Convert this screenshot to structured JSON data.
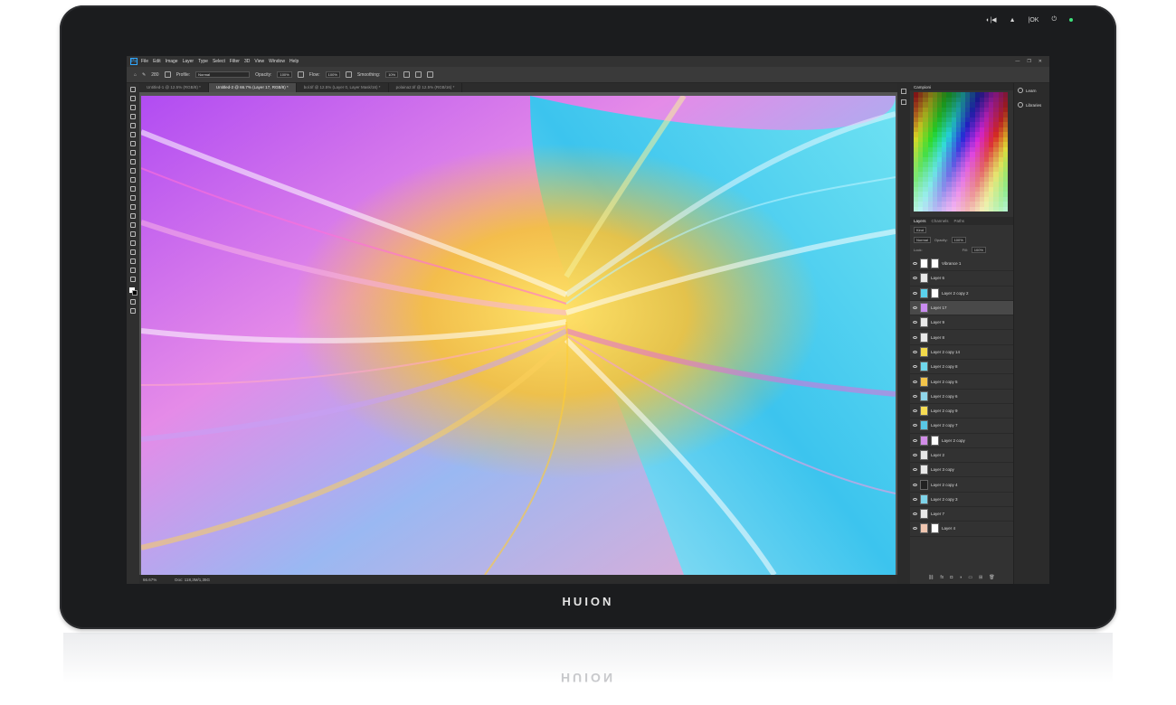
{
  "device": {
    "brand": "HUION",
    "bezel_icons": [
      "power-menu-icon",
      "back-icon",
      "up-icon",
      "ok-icon",
      "power-icon"
    ],
    "bezel_labels": {
      "menu": "◐|◀",
      "up": "▲",
      "ok": "|OK",
      "power": "⏻"
    },
    "led_color": "#3ee07a"
  },
  "app": {
    "menu": [
      "File",
      "Edit",
      "Image",
      "Layer",
      "Type",
      "Select",
      "Filter",
      "3D",
      "View",
      "Window",
      "Help"
    ],
    "window_controls": [
      "—",
      "❐",
      "✕"
    ],
    "options": {
      "profile_label": "Profile:",
      "mode_value": "Normal",
      "opacity_label": "Opacity:",
      "opacity_value": "100%",
      "flow_label": "Flow:",
      "flow_value": "100%",
      "smoothing_label": "Smoothing:",
      "smoothing_value": "10%",
      "brush_size": "280"
    },
    "tabs": [
      {
        "label": "Untitled-1 @ 12.5% (RGB/8) *",
        "active": false
      },
      {
        "label": "Untitled-2 @ 66.7% (Layer 17, RGB/8) *",
        "active": true
      },
      {
        "label": "bol.tif @ 12.5% (Layer 0, Layer Mask/16) *",
        "active": false
      },
      {
        "label": "polaina2.tif @ 12.5% (RGB/16) *",
        "active": false
      }
    ],
    "status": {
      "zoom": "66.67%",
      "doc": "Doc: 118,3M/1,35G"
    },
    "accent": "#31a8ff"
  },
  "panels": {
    "swatches_title": "Campioni",
    "layers_tabs": [
      "Layers",
      "Channels",
      "Paths"
    ],
    "kind_value": "Kind",
    "blend_value": "Normal",
    "opacity_label": "Opacity:",
    "opacity_value": "100%",
    "lock_label": "Lock:",
    "fill_label": "Fill:",
    "fill_value": "100%",
    "layers": [
      {
        "name": "Vibrance 1",
        "thumb": "#ffffff",
        "mask": true,
        "selected": false
      },
      {
        "name": "Layer 6",
        "thumb": "#e8e8e8",
        "mask": false,
        "selected": false
      },
      {
        "name": "Layer 2 copy 2",
        "thumb": "#5ad1ec",
        "mask": true,
        "selected": false
      },
      {
        "name": "Layer 17",
        "thumb": "#c98cf0",
        "mask": false,
        "selected": true
      },
      {
        "name": "Layer 9",
        "thumb": "#e8e8e8",
        "mask": false,
        "selected": false
      },
      {
        "name": "Layer 8",
        "thumb": "#e8e8e8",
        "mask": false,
        "selected": false
      },
      {
        "name": "Layer 2 copy 14",
        "thumb": "#f2d94a",
        "mask": false,
        "selected": false
      },
      {
        "name": "Layer 2 copy 8",
        "thumb": "#6fd7ec",
        "mask": false,
        "selected": false
      },
      {
        "name": "Layer 2 copy 5",
        "thumb": "#f2c44a",
        "mask": false,
        "selected": false
      },
      {
        "name": "Layer 2 copy 6",
        "thumb": "#8fd6ea",
        "mask": false,
        "selected": false
      },
      {
        "name": "Layer 2 copy 9",
        "thumb": "#f6dc53",
        "mask": false,
        "selected": false
      },
      {
        "name": "Layer 2 copy 7",
        "thumb": "#59c7e6",
        "mask": false,
        "selected": false
      },
      {
        "name": "Layer 2 copy",
        "thumb": "#d28de8",
        "mask": true,
        "selected": false
      },
      {
        "name": "Layer 2",
        "thumb": "#e8e8e8",
        "mask": false,
        "selected": false
      },
      {
        "name": "Layer 3 copy",
        "thumb": "#e8e8e8",
        "mask": false,
        "selected": false
      },
      {
        "name": "Layer 2 copy 4",
        "thumb": "#222222",
        "mask": false,
        "selected": false
      },
      {
        "name": "Layer 2 copy 3",
        "thumb": "#7ed4ea",
        "mask": false,
        "selected": false
      },
      {
        "name": "Layer 7",
        "thumb": "#e8e8e8",
        "mask": false,
        "selected": false
      },
      {
        "name": "Layer 4",
        "thumb": "#f0c6b0",
        "mask": true,
        "selected": false
      }
    ],
    "footer_icons": [
      "link-icon",
      "fx-icon",
      "mask-icon",
      "adjustment-icon",
      "group-icon",
      "new-layer-icon",
      "trash-icon"
    ],
    "footer_glyphs": [
      "⛓",
      "fx",
      "◘",
      "◑",
      "▭",
      "⊞",
      "🗑"
    ]
  },
  "right_panel": {
    "items": [
      "Learn",
      "Libraries"
    ]
  }
}
